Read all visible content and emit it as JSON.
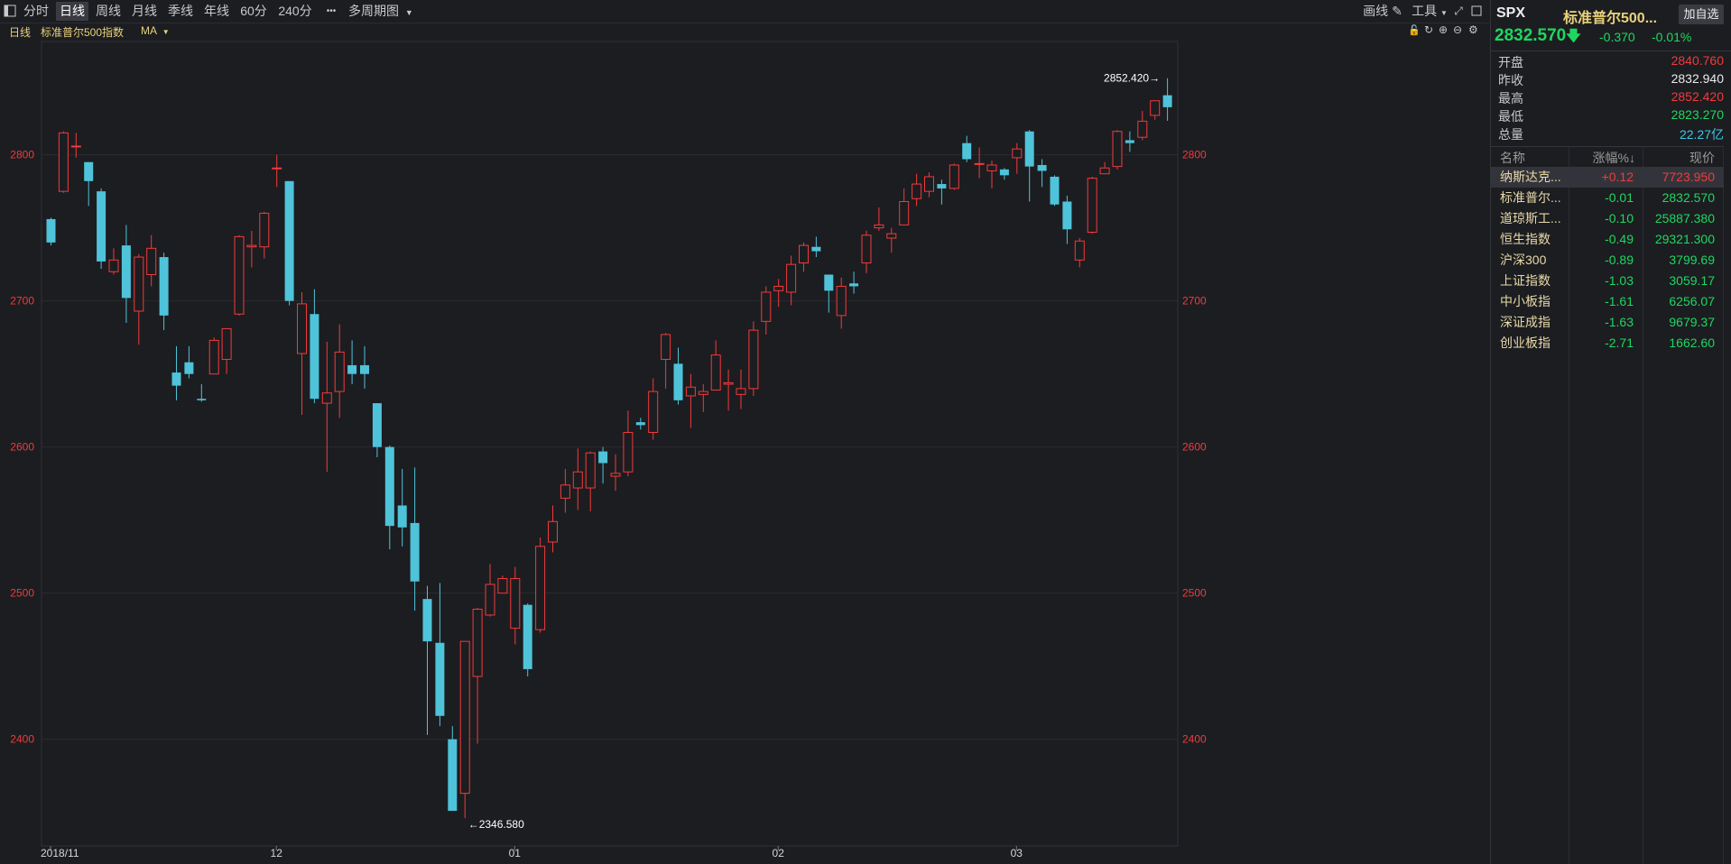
{
  "toolbar": {
    "tabs": [
      "分时",
      "日线",
      "周线",
      "月线",
      "季线",
      "年线",
      "60分",
      "240分"
    ],
    "active_tab": "日线",
    "more_label": "•••",
    "multi_period": "多周期图",
    "draw_label": "画线",
    "tools_label": "工具"
  },
  "chart_header": {
    "period": "日线",
    "name": "标准普尔500指数",
    "indicator": "MA"
  },
  "chart_data": {
    "type": "candlestick",
    "y_ticks": [
      2400,
      2500,
      2600,
      2700,
      2800
    ],
    "ylim": [
      2335,
      2872
    ],
    "x_labels": [
      {
        "label": "2018/11",
        "index": 0
      },
      {
        "label": "12",
        "index": 18
      },
      {
        "label": "01",
        "index": 37
      },
      {
        "label": "02",
        "index": 58
      },
      {
        "label": "03",
        "index": 77
      }
    ],
    "annotations": [
      {
        "text": "2852.420→",
        "index": 89,
        "value": 2852.42,
        "side": "left"
      },
      {
        "text": "←2346.580",
        "index": 33,
        "value": 2346.58,
        "side": "right"
      }
    ],
    "candles": [
      [
        2756,
        2740,
        2757,
        2738
      ],
      [
        2775,
        2815,
        2816,
        2774
      ],
      [
        2806,
        2806,
        2815,
        2798
      ],
      [
        2795,
        2782,
        2795,
        2765
      ],
      [
        2775,
        2727,
        2777,
        2722
      ],
      [
        2720,
        2728,
        2736,
        2718
      ],
      [
        2738,
        2702,
        2752,
        2685
      ],
      [
        2693,
        2730,
        2732,
        2670
      ],
      [
        2718,
        2736,
        2745,
        2710
      ],
      [
        2730,
        2690,
        2733,
        2680
      ],
      [
        2651,
        2642,
        2669,
        2632
      ],
      [
        2658,
        2650,
        2669,
        2647
      ],
      [
        2633,
        2632,
        2643,
        2631
      ],
      [
        2650,
        2673,
        2675,
        2650
      ],
      [
        2660,
        2681,
        2681,
        2650
      ],
      [
        2691,
        2744,
        2745,
        2690
      ],
      [
        2737,
        2738,
        2748,
        2723
      ],
      [
        2737,
        2760,
        2761,
        2729
      ],
      [
        2791,
        2791,
        2800,
        2778
      ],
      [
        2782,
        2700,
        2782,
        2697
      ],
      [
        2664,
        2698,
        2706,
        2622
      ],
      [
        2691,
        2633,
        2708,
        2630
      ],
      [
        2630,
        2637,
        2672,
        2583
      ],
      [
        2638,
        2665,
        2684,
        2620
      ],
      [
        2656,
        2650,
        2673,
        2643
      ],
      [
        2656,
        2650,
        2669,
        2640
      ],
      [
        2630,
        2600,
        2630,
        2593
      ],
      [
        2600,
        2546,
        2601,
        2530
      ],
      [
        2560,
        2545,
        2585,
        2532
      ],
      [
        2548,
        2508,
        2586,
        2488
      ],
      [
        2496,
        2467,
        2505,
        2403
      ],
      [
        2466,
        2416,
        2507,
        2409
      ],
      [
        2400,
        2351,
        2409,
        2351
      ],
      [
        2363,
        2467,
        2467,
        2346
      ],
      [
        2443,
        2489,
        2490,
        2397
      ],
      [
        2485,
        2506,
        2520,
        2484
      ],
      [
        2500,
        2510,
        2512,
        2500
      ],
      [
        2476,
        2510,
        2518,
        2465
      ],
      [
        2492,
        2448,
        2493,
        2443
      ],
      [
        2475,
        2532,
        2538,
        2473
      ],
      [
        2535,
        2549,
        2560,
        2528
      ],
      [
        2565,
        2574,
        2585,
        2555
      ],
      [
        2572,
        2583,
        2599,
        2557
      ],
      [
        2572,
        2596,
        2597,
        2556
      ],
      [
        2597,
        2589,
        2600,
        2575
      ],
      [
        2580,
        2582,
        2595,
        2570
      ],
      [
        2583,
        2610,
        2625,
        2580
      ],
      [
        2617,
        2615,
        2620,
        2612
      ],
      [
        2610,
        2638,
        2647,
        2605
      ],
      [
        2660,
        2677,
        2678,
        2640
      ],
      [
        2657,
        2632,
        2668,
        2629
      ],
      [
        2635,
        2641,
        2650,
        2613
      ],
      [
        2636,
        2638,
        2643,
        2624
      ],
      [
        2639,
        2663,
        2673,
        2639
      ],
      [
        2643,
        2644,
        2653,
        2625
      ],
      [
        2636,
        2640,
        2653,
        2626
      ],
      [
        2640,
        2680,
        2686,
        2635
      ],
      [
        2686,
        2706,
        2710,
        2677
      ],
      [
        2707,
        2710,
        2715,
        2696
      ],
      [
        2706,
        2725,
        2731,
        2697
      ],
      [
        2726,
        2738,
        2740,
        2720
      ],
      [
        2737,
        2734,
        2744,
        2730
      ],
      [
        2718,
        2707,
        2718,
        2692
      ],
      [
        2690,
        2710,
        2716,
        2681
      ],
      [
        2712,
        2710,
        2720,
        2705
      ],
      [
        2726,
        2745,
        2748,
        2719
      ],
      [
        2750,
        2752,
        2764,
        2748
      ],
      [
        2743,
        2746,
        2750,
        2733
      ],
      [
        2752,
        2768,
        2777,
        2752
      ],
      [
        2770,
        2780,
        2787,
        2765
      ],
      [
        2775,
        2785,
        2788,
        2771
      ],
      [
        2780,
        2777,
        2783,
        2766
      ],
      [
        2777,
        2793,
        2794,
        2776
      ],
      [
        2808,
        2797,
        2813,
        2795
      ],
      [
        2794,
        2794,
        2805,
        2784
      ],
      [
        2789,
        2793,
        2796,
        2777
      ],
      [
        2790,
        2786,
        2791,
        2783
      ],
      [
        2798,
        2804,
        2808,
        2787
      ],
      [
        2816,
        2792,
        2817,
        2768
      ],
      [
        2793,
        2789,
        2797,
        2778
      ],
      [
        2785,
        2766,
        2786,
        2765
      ],
      [
        2768,
        2749,
        2772,
        2739
      ],
      [
        2728,
        2741,
        2743,
        2723
      ],
      [
        2747,
        2784,
        2785,
        2746
      ],
      [
        2787,
        2791,
        2795,
        2787
      ],
      [
        2792,
        2816,
        2817,
        2790
      ],
      [
        2810,
        2808,
        2816,
        2802
      ],
      [
        2812,
        2823,
        2830,
        2810
      ],
      [
        2827,
        2837,
        2837,
        2824
      ],
      [
        2840.76,
        2832.57,
        2852.42,
        2823.27
      ]
    ]
  },
  "quote": {
    "symbol": "SPX",
    "name": "标准普尔500...",
    "add_watch": "加自选",
    "price": "2832.570",
    "change": "-0.370",
    "change_pct": "-0.01%",
    "open_label": "开盘",
    "open": "2840.760",
    "prev_label": "昨收",
    "prev": "2832.940",
    "high_label": "最高",
    "high": "2852.420",
    "low_label": "最低",
    "low": "2823.270",
    "vol_label": "总量",
    "vol": "22.27亿"
  },
  "watchlist": {
    "headers": [
      "名称",
      "涨幅%↓",
      "现价"
    ],
    "rows": [
      {
        "name": "纳斯达克...",
        "chg": "+0.12",
        "price": "7723.950",
        "dir": "up"
      },
      {
        "name": "标准普尔...",
        "chg": "-0.01",
        "price": "2832.570",
        "dir": "down"
      },
      {
        "name": "道琼斯工...",
        "chg": "-0.10",
        "price": "25887.380",
        "dir": "down"
      },
      {
        "name": "恒生指数",
        "chg": "-0.49",
        "price": "29321.300",
        "dir": "down"
      },
      {
        "name": "沪深300",
        "chg": "-0.89",
        "price": "3799.69",
        "dir": "down"
      },
      {
        "name": "上证指数",
        "chg": "-1.03",
        "price": "3059.17",
        "dir": "down"
      },
      {
        "name": "中小板指",
        "chg": "-1.61",
        "price": "6256.07",
        "dir": "down"
      },
      {
        "name": "深证成指",
        "chg": "-1.63",
        "price": "9679.37",
        "dir": "down"
      },
      {
        "name": "创业板指",
        "chg": "-2.71",
        "price": "1662.60",
        "dir": "down"
      }
    ]
  },
  "colors": {
    "up": "#f23a3a",
    "down": "#4fc3d9",
    "grid": "#2a2b31",
    "bg": "#1c1d21"
  },
  "icons": [
    "panel-toggle-icon",
    "pencil-icon",
    "fullscreen-icon",
    "restore-icon",
    "close-icon",
    "lock-icon",
    "refresh-icon",
    "zoom-in-icon",
    "zoom-out-icon",
    "settings-icon"
  ]
}
